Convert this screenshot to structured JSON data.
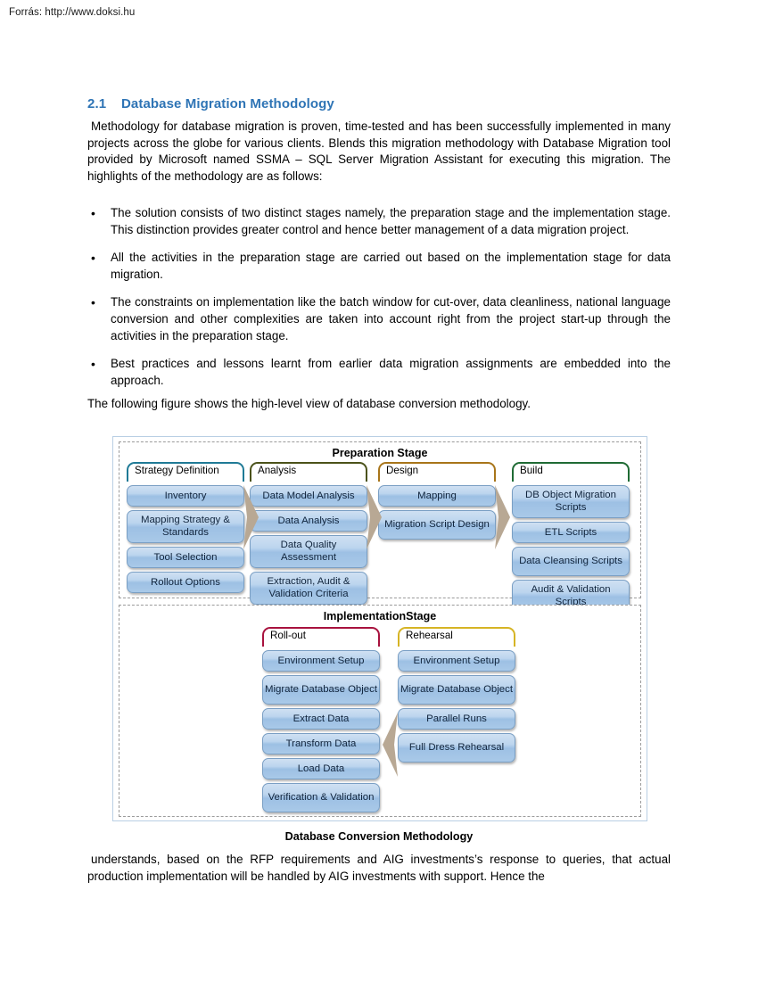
{
  "source": {
    "label": "Forrás: http://www.doksi.hu"
  },
  "heading": {
    "number": "2.1",
    "title": "Database Migration Methodology"
  },
  "intro": "Methodology for database migration is proven, time-tested and has been successfully implemented in many projects across the globe for various clients.  Blends this migration methodology with Database Migration tool provided by Microsoft named SSMA – SQL Server Migration Assistant for executing this migration. The highlights of the methodology are as follows:",
  "bullet_mark": "•",
  "bullets": [
    "The solution consists of two distinct stages namely, the preparation stage and the implementation stage. This distinction provides greater control and hence better management of a data migration project.",
    "All the activities in the preparation stage are carried out based on the implementation stage for data migration.",
    "The constraints on implementation like the batch window for cut-over, data cleanliness, national language conversion and other complexities are taken into account right from the project start-up through the activities in the preparation stage.",
    "Best practices and lessons learnt from earlier data migration assignments are embedded into the approach."
  ],
  "lead_in": "The following figure shows the high-level view of  database conversion methodology.",
  "figure": {
    "caption": "Database Conversion Methodology",
    "preparation": {
      "title": "Preparation Stage",
      "columns": [
        {
          "label": "Strategy Definition",
          "bracket_color": "#1f7a96",
          "nodes": [
            {
              "text": "Inventory",
              "lines": 1
            },
            {
              "text": "Mapping Strategy & Standards",
              "lines": 2
            },
            {
              "text": "Tool Selection",
              "lines": 1
            },
            {
              "text": "Rollout Options",
              "lines": 1
            }
          ]
        },
        {
          "label": "Analysis",
          "bracket_color": "#4b521a",
          "nodes": [
            {
              "text": "Data Model Analysis",
              "lines": 1
            },
            {
              "text": "Data Analysis",
              "lines": 1
            },
            {
              "text": "Data Quality Assessment",
              "lines": 2
            },
            {
              "text": "Extraction, Audit & Validation Criteria",
              "lines": 2
            }
          ]
        },
        {
          "label": "Design",
          "bracket_color": "#a8751a",
          "nodes": [
            {
              "text": "Mapping",
              "lines": 1
            },
            {
              "text": "Migration Script Design",
              "lines": 2
            }
          ]
        },
        {
          "label": "Build",
          "bracket_color": "#1f6b34",
          "nodes": [
            {
              "text": "DB Object Migration Scripts",
              "lines": 2
            },
            {
              "text": "ETL Scripts",
              "lines": 1
            },
            {
              "text": "Data Cleansing Scripts",
              "lines": 2
            },
            {
              "text": "Audit & Validation Scripts",
              "lines": 2
            }
          ]
        }
      ]
    },
    "implementation": {
      "title": "ImplementationStage",
      "columns": [
        {
          "label": "Roll-out",
          "bracket_color": "#a8123e",
          "nodes": [
            {
              "text": "Environment Setup",
              "lines": 1
            },
            {
              "text": "Migrate Database Object",
              "lines": 2
            },
            {
              "text": "Extract Data",
              "lines": 1
            },
            {
              "text": "Transform Data",
              "lines": 1
            },
            {
              "text": "Load Data",
              "lines": 1
            },
            {
              "text": "Verification & Validation",
              "lines": 2
            }
          ]
        },
        {
          "label": "Rehearsal",
          "bracket_color": "#d6b424",
          "nodes": [
            {
              "text": "Environment Setup",
              "lines": 1
            },
            {
              "text": "Migrate Database Object",
              "lines": 2
            },
            {
              "text": "Parallel Runs",
              "lines": 1
            },
            {
              "text": "Full Dress Rehearsal",
              "lines": 2
            }
          ]
        }
      ]
    },
    "arrow_color": "#b8a894"
  },
  "tail": "understands, based on the RFP requirements and AIG investments’s response to  queries, that actual production implementation will be handled by AIG investments with  support. Hence the"
}
